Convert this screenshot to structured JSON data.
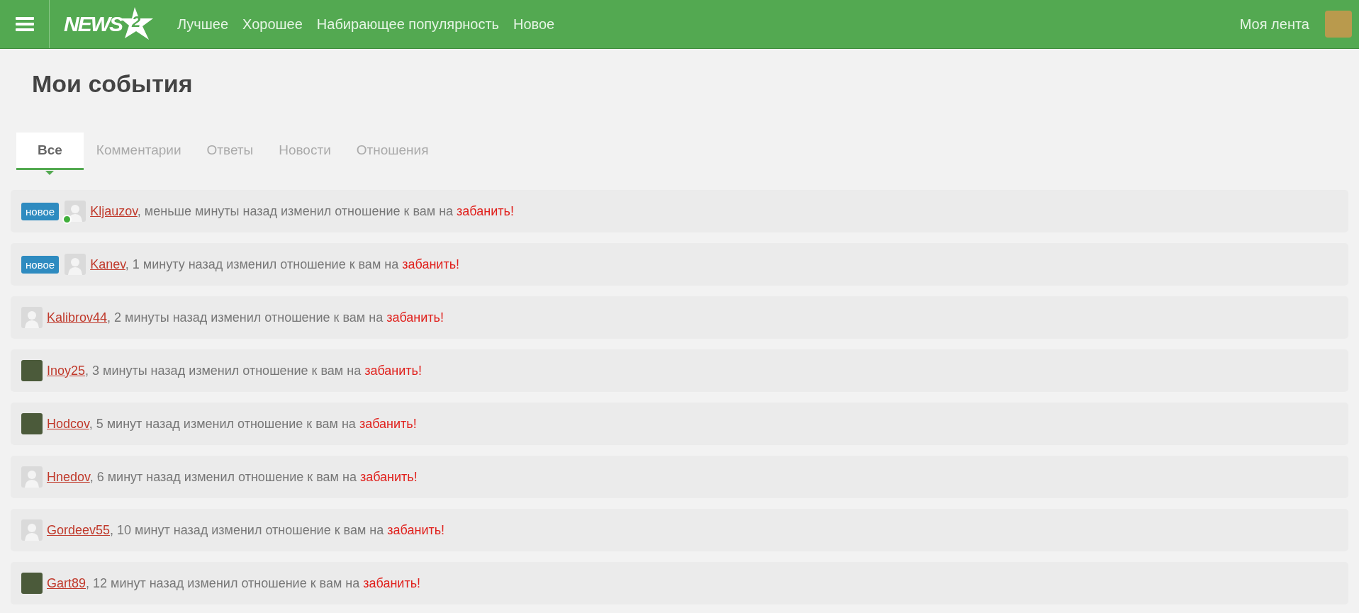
{
  "header": {
    "logo": {
      "text": "NEWS",
      "badge": "2"
    },
    "nav": [
      "Лучшее",
      "Хорошее",
      "Набирающее популярность",
      "Новое"
    ],
    "my_feed": "Моя лента"
  },
  "page_title": "Мои события",
  "tabs": [
    {
      "label": "Все",
      "selected": true
    },
    {
      "label": "Комментарии",
      "selected": false
    },
    {
      "label": "Ответы",
      "selected": false
    },
    {
      "label": "Новости",
      "selected": false
    },
    {
      "label": "Отношения",
      "selected": false
    }
  ],
  "events": [
    {
      "badge": "новое",
      "custom_avatar": false,
      "online": true,
      "user": "Kljauzov",
      "text": ", меньше минуты назад изменил отношение к вам на ",
      "action": "забанить!"
    },
    {
      "badge": "новое",
      "custom_avatar": false,
      "online": false,
      "user": "Kanev",
      "text": ", 1 минуту назад изменил отношение к вам на ",
      "action": "забанить!"
    },
    {
      "custom_avatar": false,
      "online": false,
      "user": "Kalibrov44",
      "text": ", 2 минуты назад изменил отношение к вам на ",
      "action": "забанить!"
    },
    {
      "custom_avatar": true,
      "online": false,
      "user": "Inoy25",
      "text": ", 3 минуты назад изменил отношение к вам на ",
      "action": "забанить!"
    },
    {
      "custom_avatar": true,
      "online": false,
      "user": "Hodcov",
      "text": ", 5 минут назад изменил отношение к вам на ",
      "action": "забанить!"
    },
    {
      "custom_avatar": false,
      "online": false,
      "user": "Hnedov",
      "text": ", 6 минут назад изменил отношение к вам на ",
      "action": "забанить!"
    },
    {
      "custom_avatar": false,
      "online": false,
      "user": "Gordeev55",
      "text": ", 10 минут назад изменил отношение к вам на ",
      "action": "забанить!"
    },
    {
      "custom_avatar": true,
      "online": false,
      "user": "Gart89",
      "text": ", 12 минут назад изменил отношение к вам на ",
      "action": "забанить!"
    }
  ]
}
